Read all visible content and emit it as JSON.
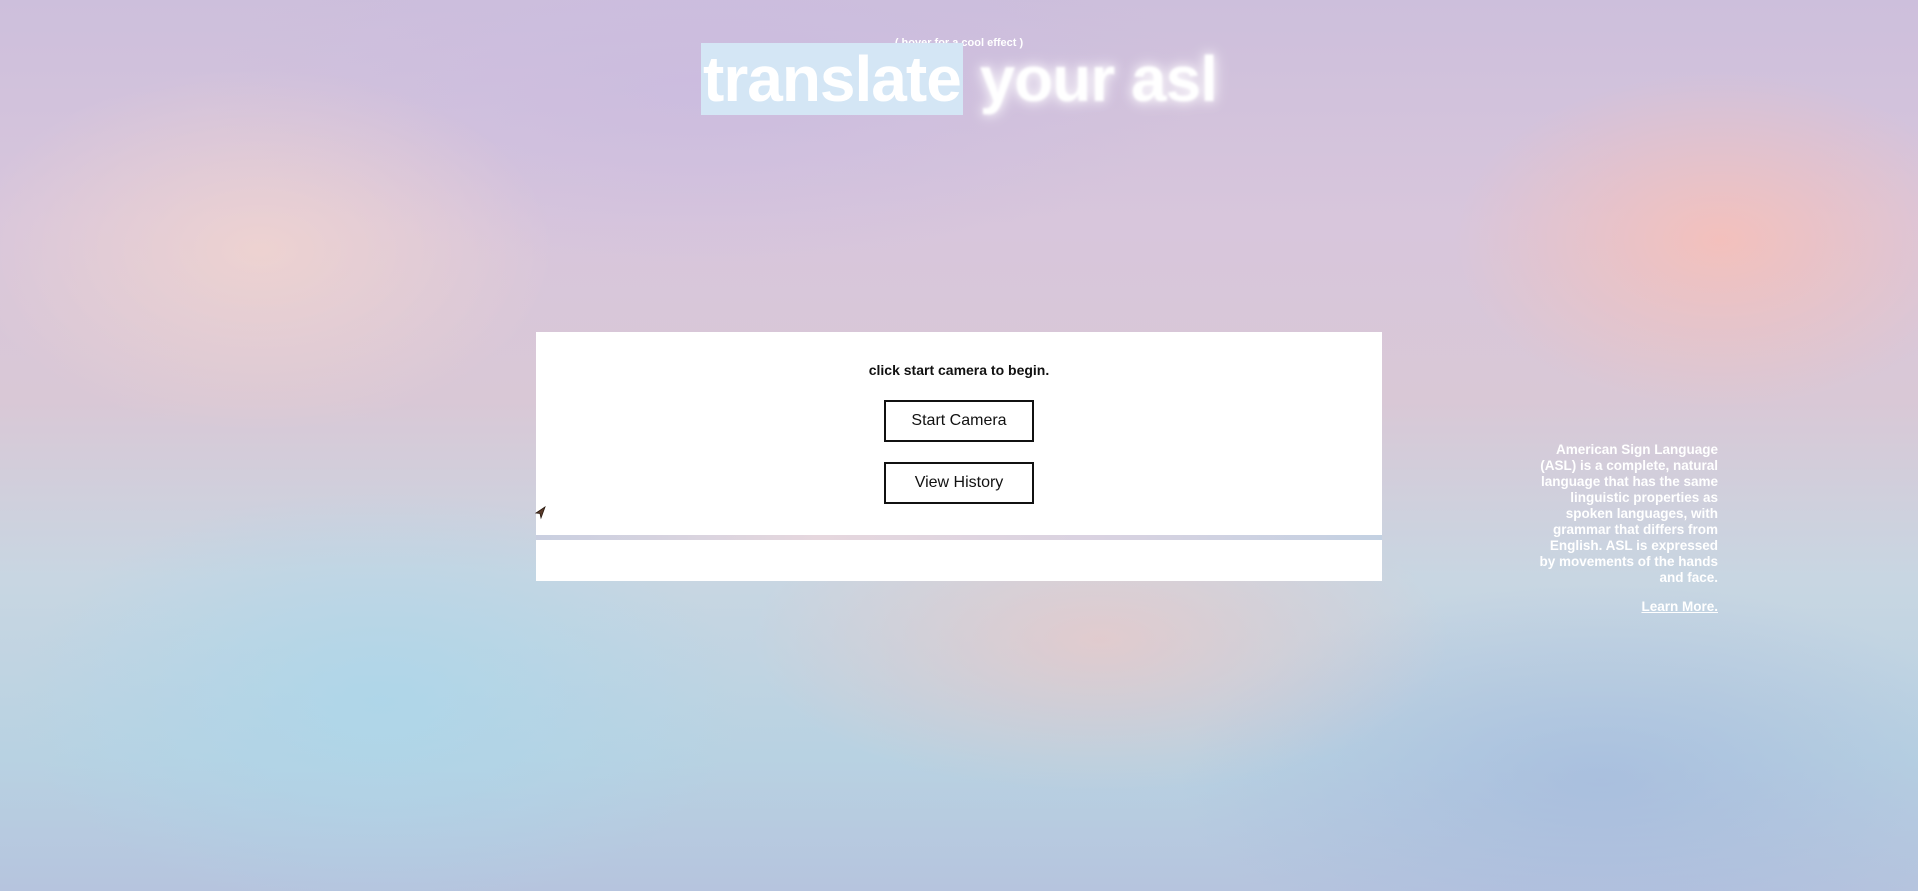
{
  "header": {
    "hover_hint": "( hover for a cool effect )",
    "title_word_1": "translate",
    "title_word_2": "your",
    "title_word_3": "asl"
  },
  "card": {
    "prompt": "click start camera to begin.",
    "start_camera_label": "Start Camera",
    "view_history_label": "View History"
  },
  "info": {
    "description": "American Sign Language (ASL) is a complete, natural language that has the same linguistic properties as spoken languages, with grammar that differs from English. ASL is expressed by movements of the hands and face.",
    "learn_more_label": "Learn More."
  },
  "colors": {
    "highlight": "#d4e6f5",
    "text_light": "#ffffff",
    "text_dark": "#111111"
  },
  "icons": {
    "cursor": "mouse-pointer-icon"
  }
}
